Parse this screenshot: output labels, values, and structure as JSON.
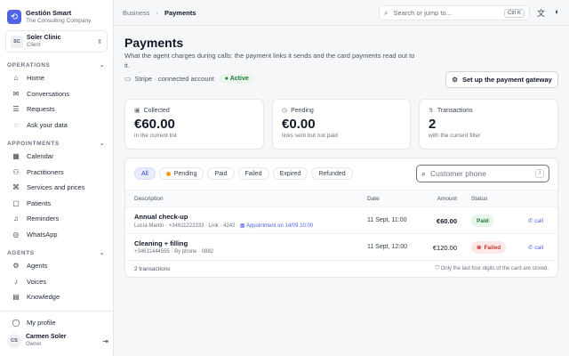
{
  "brand": {
    "name": "Gestión Smart",
    "subtitle": "The Consulting Company"
  },
  "org": {
    "badge": "SC",
    "name": "Soler Clinic",
    "role": "Client"
  },
  "sections": [
    {
      "title": "OPERATIONS",
      "items": [
        {
          "label": "Home",
          "icon": "home-icon"
        },
        {
          "label": "Conversations",
          "icon": "message-icon"
        },
        {
          "label": "Requests",
          "icon": "list-icon"
        },
        {
          "label": "Ask your data",
          "icon": "chat-icon"
        }
      ]
    },
    {
      "title": "APPOINTMENTS",
      "items": [
        {
          "label": "Calendar",
          "icon": "calendar-icon"
        },
        {
          "label": "Practitioners",
          "icon": "users-icon"
        },
        {
          "label": "Services and prices",
          "icon": "tag-icon"
        },
        {
          "label": "Patients",
          "icon": "patient-icon"
        },
        {
          "label": "Reminders",
          "icon": "bell-icon"
        },
        {
          "label": "WhatsApp",
          "icon": "whatsapp-icon"
        }
      ]
    },
    {
      "title": "AGENTS",
      "items": [
        {
          "label": "Agents",
          "icon": "agent-icon"
        },
        {
          "label": "Voices",
          "icon": "voice-icon"
        },
        {
          "label": "Knowledge",
          "icon": "book-icon"
        }
      ]
    }
  ],
  "profile": {
    "label": "My profile"
  },
  "user": {
    "initials": "CS",
    "name": "Carmen Soler",
    "role": "Owner"
  },
  "topbar": {
    "breadcrumb_parent": "Business",
    "breadcrumb_current": "Payments",
    "search_placeholder": "Search or jump to...",
    "search_shortcut": "Ctrl K"
  },
  "page": {
    "title": "Payments",
    "subtitle": "What the agent charges during calls: the payment links it sends and the card payments read out to it.",
    "gateway_status": "Stripe · connected account",
    "gateway_badge": "Active",
    "gateway_button": "Set up the payment gateway"
  },
  "cards": [
    {
      "label": "Collected",
      "value": "€60.00",
      "sub": "in the current list",
      "icon": "wallet-icon"
    },
    {
      "label": "Pending",
      "value": "€0.00",
      "sub": "links sent but not paid",
      "icon": "clock-icon"
    },
    {
      "label": "Transactions",
      "value": "2",
      "sub": "with the current filter",
      "icon": "activity-icon"
    }
  ],
  "filters": [
    "All",
    "Pending",
    "Paid",
    "Failed",
    "Expired",
    "Refunded"
  ],
  "customer_search": {
    "placeholder": "Customer phone",
    "shortcut": "/"
  },
  "table": {
    "headers": {
      "description": "Description",
      "date": "Date",
      "amount": "Amount",
      "status": "Status"
    },
    "rows": [
      {
        "title": "Annual check-up",
        "meta": "Lucía Martín · +34611222333 · Link · 4242 · ",
        "appointment": "Appointment on 14/09 10:00",
        "date": "11 Sept, 11:00",
        "amount": "€60.00",
        "status": "Paid",
        "action": "call"
      },
      {
        "title": "Cleaning + filling",
        "meta": "+34611444555 · By phone · 0882",
        "appointment": "",
        "date": "11 Sept, 12:00",
        "amount": "€120.00",
        "status": "Failed",
        "action": "call"
      }
    ],
    "footer_count": "2 transactions",
    "footer_note": "Only the last four digits of the card are stored."
  },
  "colors": {
    "accent": "#4f63e7",
    "paid": "#1f7a3a",
    "failed": "#c0392b"
  }
}
